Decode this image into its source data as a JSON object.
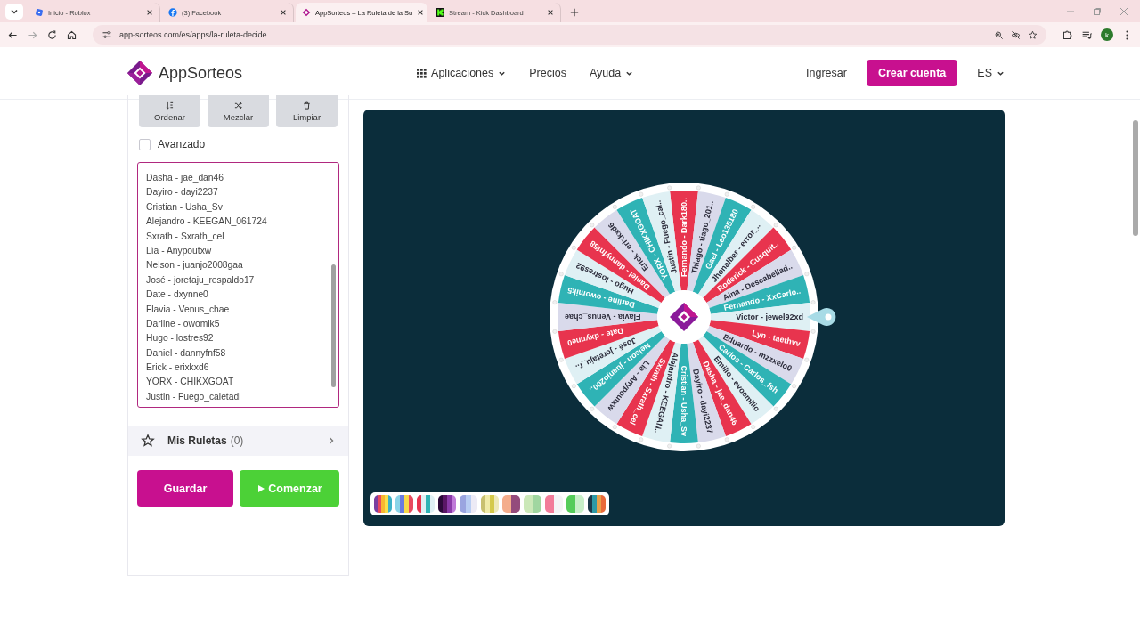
{
  "browser": {
    "tabs": [
      {
        "title": "Inicio - Roblox",
        "kind": "roblox",
        "selected": false
      },
      {
        "title": "(3) Facebook",
        "kind": "facebook",
        "selected": false
      },
      {
        "title": "AppSorteos – La Ruleta de la Su",
        "kind": "appsorteos",
        "selected": true
      },
      {
        "title": "Stream - Kick Dashboard",
        "kind": "kick",
        "selected": false
      }
    ],
    "url": "app-sorteos.com/es/apps/la-ruleta-decide",
    "profile_initial": "k"
  },
  "header": {
    "logo": "AppSorteos",
    "nav": [
      {
        "label": "Aplicaciones",
        "kind": "apps"
      },
      {
        "label": "Precios",
        "kind": "plain"
      },
      {
        "label": "Ayuda",
        "kind": "menu"
      }
    ],
    "login": "Ingresar",
    "signup": "Crear cuenta",
    "language": "ES"
  },
  "tools": [
    {
      "label": "Ordenar",
      "kind": "sort"
    },
    {
      "label": "Mezclar",
      "kind": "shuffle"
    },
    {
      "label": "Limpiar",
      "kind": "trash"
    }
  ],
  "advanced": {
    "label": "Avanzado",
    "checked": false
  },
  "entries": [
    "Dasha - jae_dan46",
    "Dayiro  - dayi2237",
    "Cristian - Usha_Sv",
    "Alejandro - KEEGAN_061724",
    "Sxrath - Sxrath_cel",
    "Lía - Anypoutxw",
    "Nelson - juanjo2008gaa",
    "José -  joretaju_respaldo17",
    "Date - dxynne0",
    "Flavia - Venus_chae",
    "Darline - owomik5",
    "Hugo - lostres92",
    "Daniel - dannyfnf58",
    "Erick - erixkxd6",
    "YORX - CHIKXGOAT",
    "Justin - Fuego_caletadl"
  ],
  "my_wheels": {
    "label": "Mis Ruletas",
    "count": "(0)"
  },
  "actions": {
    "save": "Guardar",
    "start": "Comenzar"
  },
  "wheel": {
    "segments": [
      {
        "label": "Fernando - Dark180..",
        "color": "#e8344e"
      },
      {
        "label": "Thiago - tiago_201..",
        "color": "#d9daeb"
      },
      {
        "label": "Gael - Leo135180",
        "color": "#2fb3b5"
      },
      {
        "label": "Jhonalber - error_..",
        "color": "#dff0f4"
      },
      {
        "label": "Roderick - Cusquit..",
        "color": "#e8344e"
      },
      {
        "label": "Aina - Descabellad..",
        "color": "#d9daeb"
      },
      {
        "label": "Fernando - XxCarlo..",
        "color": "#2fb3b5"
      },
      {
        "label": "Victor - jewel92xd",
        "color": "#dff0f4"
      },
      {
        "label": "Lyn - taethvv",
        "color": "#e8344e"
      },
      {
        "label": "Eduardo - mzzxelo0",
        "color": "#d9daeb"
      },
      {
        "label": "Carlos - Carlos_fsh",
        "color": "#2fb3b5"
      },
      {
        "label": "Emilio - evoemilio",
        "color": "#dff0f4"
      },
      {
        "label": "Dasha - jae_dan46",
        "color": "#e8344e"
      },
      {
        "label": "Dayiro - dayi2237",
        "color": "#d9daeb"
      },
      {
        "label": "Cristian - Usha_Sv",
        "color": "#2fb3b5"
      },
      {
        "label": "Alejandro - KEEGAN..",
        "color": "#dff0f4"
      },
      {
        "label": "Sxrath - Sxrath_cel",
        "color": "#e8344e"
      },
      {
        "label": "Lía - Anypoutxw",
        "color": "#d9daeb"
      },
      {
        "label": "Nelson - juanjo200..",
        "color": "#2fb3b5"
      },
      {
        "label": "José - joretaju_r..",
        "color": "#dff0f4"
      },
      {
        "label": "Date - dxynne0",
        "color": "#e8344e"
      },
      {
        "label": "Flavia - Venus_chae",
        "color": "#d9daeb"
      },
      {
        "label": "Darline - owomik5",
        "color": "#2fb3b5"
      },
      {
        "label": "Hugo - lostres92",
        "color": "#dff0f4"
      },
      {
        "label": "Daniel - dannyfnf58",
        "color": "#e8344e"
      },
      {
        "label": "Erick - erixkxd6",
        "color": "#d9daeb"
      },
      {
        "label": "YORX - CHIKXGOAT",
        "color": "#2fb3b5"
      },
      {
        "label": "Justin - Fuego_cal..",
        "color": "#dff0f4"
      }
    ]
  }
}
